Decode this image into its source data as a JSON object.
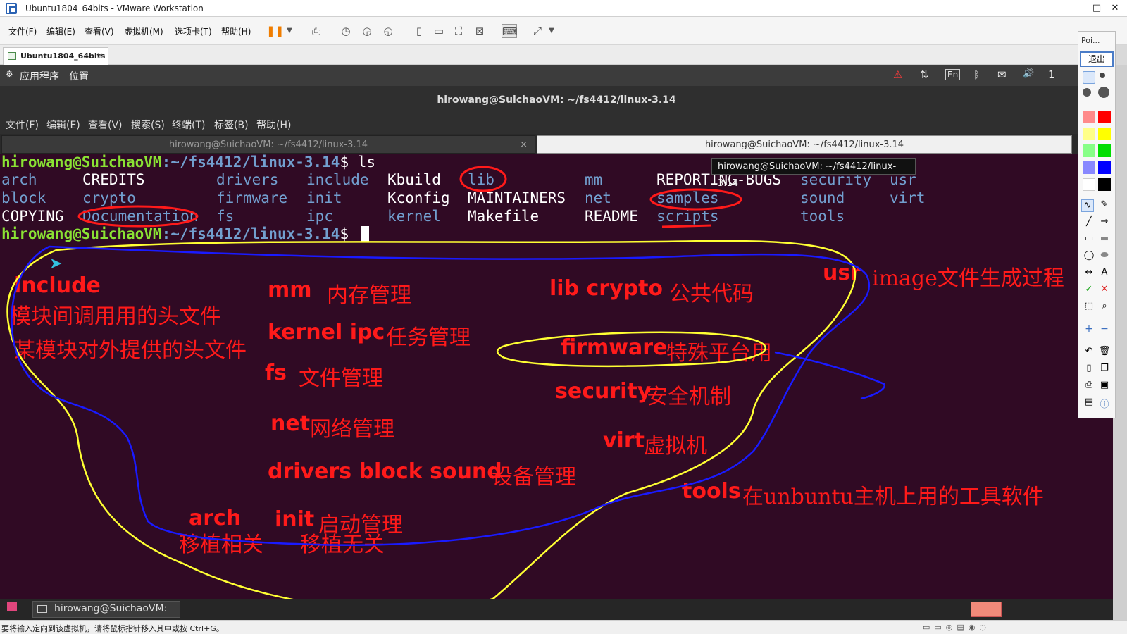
{
  "vmware": {
    "window_title": "Ubuntu1804_64bits - VMware Workstation",
    "win_controls": [
      "–",
      "□",
      "✕"
    ],
    "menu": [
      "文件(F)",
      "编辑(E)",
      "查看(V)",
      "虚拟机(M)",
      "选项卡(T)",
      "帮助(H)"
    ],
    "tab_label": "Ubuntu1804_64bits",
    "tab_close": "×",
    "status_text": "要将输入定向到该虚拟机，请将鼠标指针移入其中或按 Ctrl+G。"
  },
  "guest_panel": {
    "apps": "应用程序",
    "places": "位置",
    "indicators": [
      "⚠",
      "⇅",
      "En",
      "ᛒ",
      "✉",
      "🔊",
      "1"
    ]
  },
  "terminal": {
    "title": "hirowang@SuichaoVM: ~/fs4412/linux-3.14",
    "menu": [
      "文件(F)",
      "编辑(E)",
      "查看(V)",
      "搜索(S)",
      "终端(T)",
      "标签(B)",
      "帮助(H)"
    ],
    "tabs": [
      "hirowang@SuichaoVM: ~/fs4412/linux-3.14",
      "hirowang@SuichaoVM: ~/fs4412/linux-3.14"
    ],
    "tab_close": "×",
    "tooltip": "hirowang@SuichaoVM: ~/fs4412/linux-3.14",
    "prompt_user": "hirowang@SuichaoVM",
    "prompt_path": ":~/fs4412/linux-3.14",
    "prompt_dollar": "$",
    "command": " ls",
    "listing": {
      "col1": [
        "arch",
        "block",
        "COPYING"
      ],
      "col2": [
        "CREDITS",
        "crypto",
        "Documentation"
      ],
      "col3": [
        "drivers",
        "firmware",
        "fs"
      ],
      "col4": [
        "include",
        "init",
        "ipc"
      ],
      "col5": [
        "Kbuild",
        "Kconfig",
        "kernel"
      ],
      "col6": [
        "lib",
        "MAINTAINERS",
        "Makefile"
      ],
      "col7": [
        "mm",
        "net",
        "README"
      ],
      "col8": [
        "REPORTING-BUGS",
        "samples",
        "scripts"
      ],
      "col9": [
        "security",
        "sound",
        "tools"
      ],
      "col10": [
        "usr",
        "virt"
      ]
    }
  },
  "annotations": {
    "include": "include",
    "include_desc1": "模块间调用用的头文件",
    "include_desc2": "某模块对外提供的头文件",
    "mm": "mm",
    "mm_desc": "内存管理",
    "kernel_ipc": "kernel ipc",
    "kernel_ipc_desc": "任务管理",
    "fs": "fs",
    "fs_desc": "文件管理",
    "net": "net",
    "net_desc": "网络管理",
    "drivers": "drivers block sound",
    "drivers_desc": "设备管理",
    "arch": "arch",
    "arch_desc": "移植相关",
    "init": "init",
    "init_desc": "启动管理",
    "init_desc2": "移植无关",
    "lib_crypto": "lib crypto",
    "lib_crypto_desc": "公共代码",
    "firmware": "firmware",
    "firmware_desc": "特殊平台用",
    "security": "security",
    "security_desc": "安全机制",
    "virt": "virt",
    "virt_desc": "虚拟机",
    "usr": "usr",
    "usr_desc": "image文件生成过程",
    "tools": "tools",
    "tools_desc": "在unbuntu主机上用的工具软件"
  },
  "taskbar": {
    "item": "hirowang@SuichaoVM: ..."
  },
  "palette": {
    "header": "Poi...",
    "exit": "退出"
  },
  "colors": {
    "terminal_bg": "#300a24",
    "prompt_green": "#8ae234",
    "dir_blue": "#729fcf",
    "annotation_red": "#ff1a1a",
    "pen_yellow": "#ffff33",
    "pen_blue": "#1a1aff"
  }
}
